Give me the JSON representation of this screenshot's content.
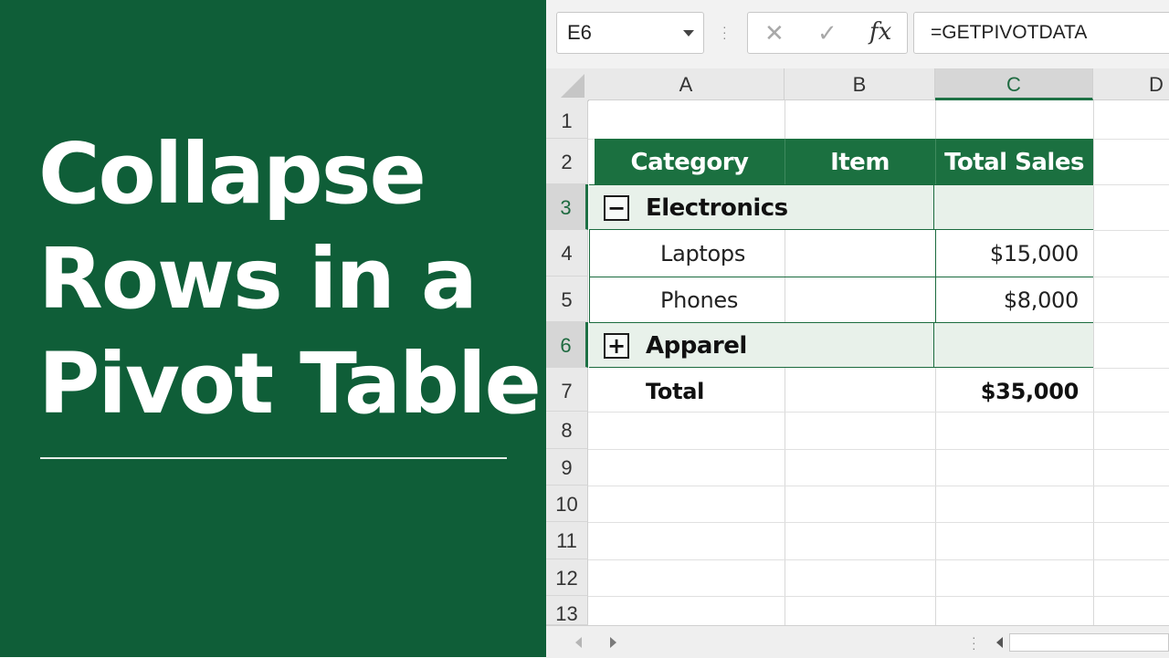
{
  "title_panel": {
    "lines": [
      "Collapse",
      "Rows in a",
      "Pivot Table"
    ],
    "background": "#0f5e38"
  },
  "formula_bar": {
    "name_box": "E6",
    "cancel_icon": "✕",
    "enter_icon": "✓",
    "function_icon": "fx",
    "formula": "=GETPIVOTDATA"
  },
  "columns": [
    "A",
    "B",
    "C",
    "D"
  ],
  "selected_column": "C",
  "rows": [
    "1",
    "2",
    "3",
    "4",
    "5",
    "6",
    "7",
    "8",
    "9",
    "10",
    "11",
    "12",
    "13"
  ],
  "selected_rows": [
    "3",
    "6"
  ],
  "pivot": {
    "headers": {
      "category": "Category",
      "item": "Item",
      "total_sales": "Total Sales"
    },
    "groups": [
      {
        "toggle": "−",
        "label": "Electronics",
        "state": "expanded",
        "items": [
          {
            "label": "Laptops",
            "value": "$15,000"
          },
          {
            "label": "Phones",
            "value": "$8,000"
          }
        ]
      },
      {
        "toggle": "+",
        "label": "Apparel",
        "state": "collapsed",
        "items": []
      }
    ],
    "total": {
      "label": "Total",
      "value": "$35,000"
    },
    "header_color": "#1b7040",
    "group_fill": "#e8f1ea"
  }
}
